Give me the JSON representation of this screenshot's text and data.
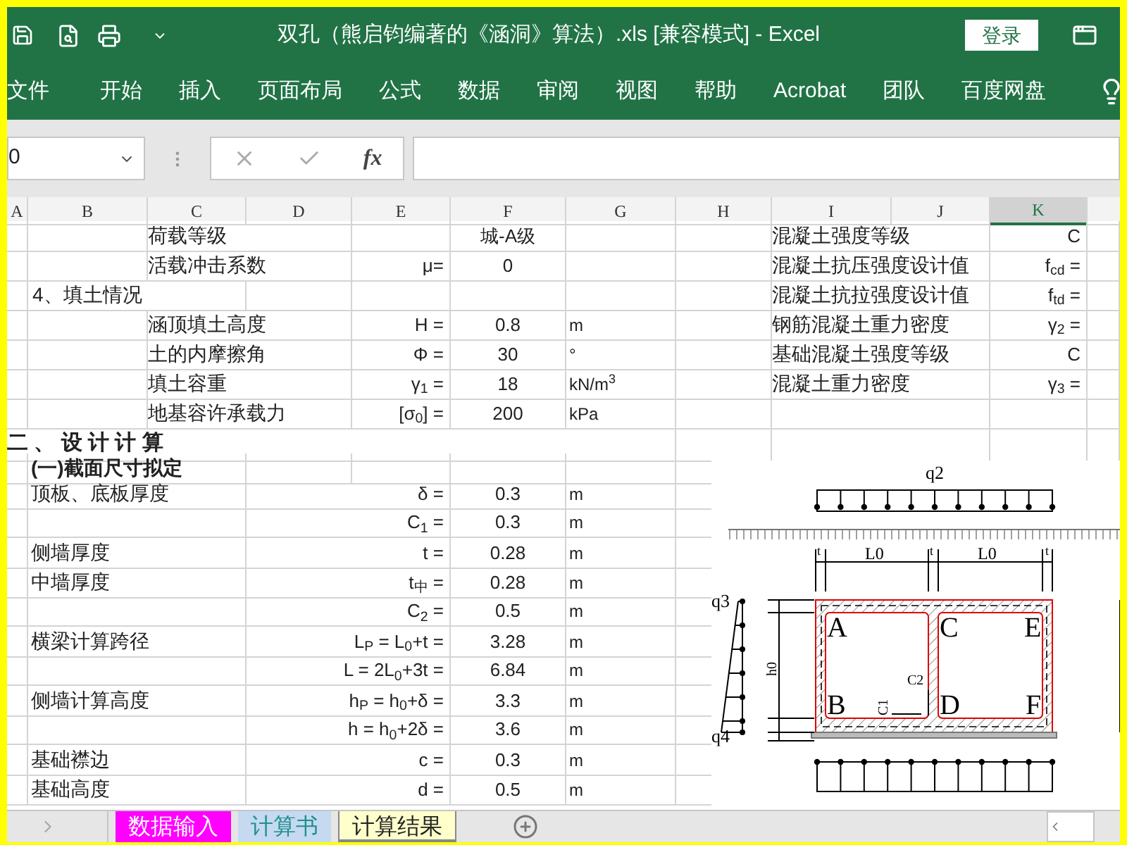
{
  "title_bar": {
    "title": "双孔（熊启钧编著的《涵洞》算法）.xls [兼容模式] - Excel",
    "login": "登录"
  },
  "ribbon_tabs": [
    "文件",
    "开始",
    "插入",
    "页面布局",
    "公式",
    "数据",
    "审阅",
    "视图",
    "帮助",
    "Acrobat",
    "团队",
    "百度网盘"
  ],
  "formula_bar": {
    "name_box": "0",
    "function_label": "fx"
  },
  "columns": [
    {
      "label": "A",
      "selected": false
    },
    {
      "label": "B",
      "selected": false
    },
    {
      "label": "C",
      "selected": false
    },
    {
      "label": "D",
      "selected": false
    },
    {
      "label": "E",
      "selected": false
    },
    {
      "label": "F",
      "selected": false
    },
    {
      "label": "G",
      "selected": false
    },
    {
      "label": "H",
      "selected": false
    },
    {
      "label": "I",
      "selected": false
    },
    {
      "label": "J",
      "selected": false
    },
    {
      "label": "K",
      "selected": true
    }
  ],
  "rows": [
    {
      "kind": "param",
      "label": "荷载等级",
      "value": "城-A级",
      "right_label": "混凝土强度等级",
      "right_symbol": "C"
    },
    {
      "kind": "param",
      "label": "活载冲击系数",
      "symbol": "μ=",
      "value": "0",
      "right_label": "混凝土抗压强度设计值",
      "right_symbol": "f$_{cd}$ ="
    },
    {
      "kind": "group",
      "label": "4、填土情况",
      "right_label": "混凝土抗拉强度设计值",
      "right_symbol": "f$_{td}$ ="
    },
    {
      "kind": "param",
      "label": "涵顶填土高度",
      "symbol": "H =",
      "value": "0.8",
      "unit": "m",
      "right_label": "钢筋混凝土重力密度",
      "right_symbol": "γ$_{2}$ ="
    },
    {
      "kind": "param",
      "label": "土的内摩擦角",
      "symbol": "Φ =",
      "value": "30",
      "unit": "°",
      "right_label": "基础混凝土强度等级",
      "right_symbol": "C"
    },
    {
      "kind": "param",
      "label": "填土容重",
      "symbol": "γ$_{1}$ =",
      "value": "18",
      "unit": "kN/m$^{3}$",
      "right_label": "混凝土重力密度",
      "right_symbol": "γ$_{3}$ ="
    },
    {
      "kind": "param",
      "label": "地基容许承载力",
      "symbol": "[σ$_{0}$] =",
      "value": "200",
      "unit": "kPa"
    },
    {
      "kind": "heading",
      "label": "二 、 设 计 计 算"
    },
    {
      "kind": "subheading",
      "label": "(一)截面尺寸拟定"
    },
    {
      "kind": "calc",
      "label": "顶板、底板厚度",
      "symbol": "δ =",
      "value": "0.3",
      "unit": "m"
    },
    {
      "kind": "calc",
      "symbol": "C$_{1}$ =",
      "value": "0.3",
      "unit": "m"
    },
    {
      "kind": "calc",
      "label": "侧墙厚度",
      "symbol": "t =",
      "value": "0.28",
      "unit": "m"
    },
    {
      "kind": "calc",
      "label": "中墙厚度",
      "symbol": "t$_{中}$ =",
      "value": "0.28",
      "unit": "m"
    },
    {
      "kind": "calc",
      "symbol": "C$_{2}$ =",
      "value": "0.5",
      "unit": "m"
    },
    {
      "kind": "calc",
      "label": "横梁计算跨径",
      "symbol": "L$_{P}$ = L$_{0}$+t =",
      "value": "3.28",
      "unit": "m"
    },
    {
      "kind": "calc",
      "symbol": "L = 2L$_{0}$+3t =",
      "value": "6.84",
      "unit": "m"
    },
    {
      "kind": "calc",
      "label": "侧墙计算高度",
      "symbol": "h$_{P}$ = h$_{0}$+δ =",
      "value": "3.3",
      "unit": "m"
    },
    {
      "kind": "calc",
      "symbol": "h = h$_{0}$+2δ =",
      "value": "3.6",
      "unit": "m"
    },
    {
      "kind": "calc",
      "label": "基础襟边",
      "symbol": "c =",
      "value": "0.3",
      "unit": "m"
    },
    {
      "kind": "calc",
      "label": "基础高度",
      "symbol": "d =",
      "value": "0.5",
      "unit": "m"
    }
  ],
  "diagram": {
    "labels": [
      "q2",
      "t",
      "L0",
      "t",
      "L0",
      "t",
      "q3",
      "A",
      "C",
      "E",
      "B",
      "D",
      "F",
      "C2",
      "C1",
      "q4",
      "h0"
    ]
  },
  "sheet_tabs": [
    {
      "label": "数据输入",
      "color": "#ff00ff",
      "selected": false
    },
    {
      "label": "计算书",
      "color": "#c5d9f1",
      "selected": false
    },
    {
      "label": "计算结果",
      "color": "#ffffcc",
      "selected": true
    }
  ]
}
